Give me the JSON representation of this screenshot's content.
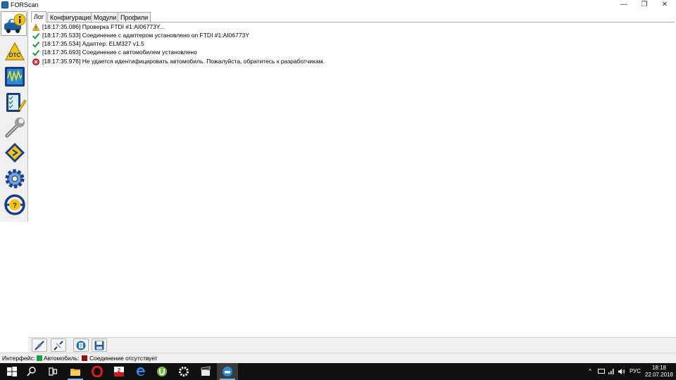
{
  "window": {
    "title": "FORScan",
    "minimize_glyph": "—",
    "maximize_glyph": "❐",
    "close_glyph": "✕"
  },
  "sidebar": {
    "items": [
      {
        "name": "info-icon",
        "active": true
      },
      {
        "name": "dtc-icon",
        "active": false
      },
      {
        "name": "oscilloscope-icon",
        "active": false
      },
      {
        "name": "checklist-icon",
        "active": false
      },
      {
        "name": "wrench-icon",
        "active": false
      },
      {
        "name": "chip-icon",
        "active": false
      },
      {
        "name": "gear-icon",
        "active": false
      },
      {
        "name": "help-steering-wheel-icon",
        "active": false
      }
    ]
  },
  "tabs": [
    {
      "label": "Лог",
      "active": true
    },
    {
      "label": "Конфигурация",
      "active": false
    },
    {
      "label": "Модули",
      "active": false
    },
    {
      "label": "Профили",
      "active": false
    }
  ],
  "log": [
    {
      "status": "warning",
      "text": "[18:17:35.086] Проверка FTDI #1:AI06773Y..."
    },
    {
      "status": "ok",
      "text": "[18:17:35.533] Соединение с адаптером установлено on FTDI #1:AI06773Y"
    },
    {
      "status": "ok",
      "text": "[18:17:35.534] Адаптер:  ELM327 v1.5"
    },
    {
      "status": "ok",
      "text": "[18:17:35.693] Соединение с автомобилем установлено"
    },
    {
      "status": "error",
      "text": "[18:17:35.976] Не удается идентифицировать автомобиль. Пожалуйста, обратитесь к разработчикам."
    }
  ],
  "bottom_toolbar": {
    "buttons": [
      "connect-icon",
      "disconnect-icon",
      "clear-log-icon",
      "save-icon"
    ]
  },
  "statusbar": {
    "interface_label": "Интерфейс:",
    "interface_color": "#1aa33a",
    "vehicle_label": "Автомобиль:",
    "vehicle_color": "#8b1010",
    "connection_status": "Соединение отсутствует"
  },
  "taskbar": {
    "apps": [
      "windows-start-icon",
      "search-icon",
      "task-view-icon",
      "file-explorer-icon",
      "opera-icon",
      "sticker-app-icon",
      "edge-icon",
      "utorrent-icon",
      "settings-gear-icon",
      "movie-clapper-icon",
      "forscan-app-icon"
    ],
    "tray": {
      "chevron": "^",
      "language": "РУС",
      "time": "18:18",
      "date": "22.07.2018"
    }
  }
}
